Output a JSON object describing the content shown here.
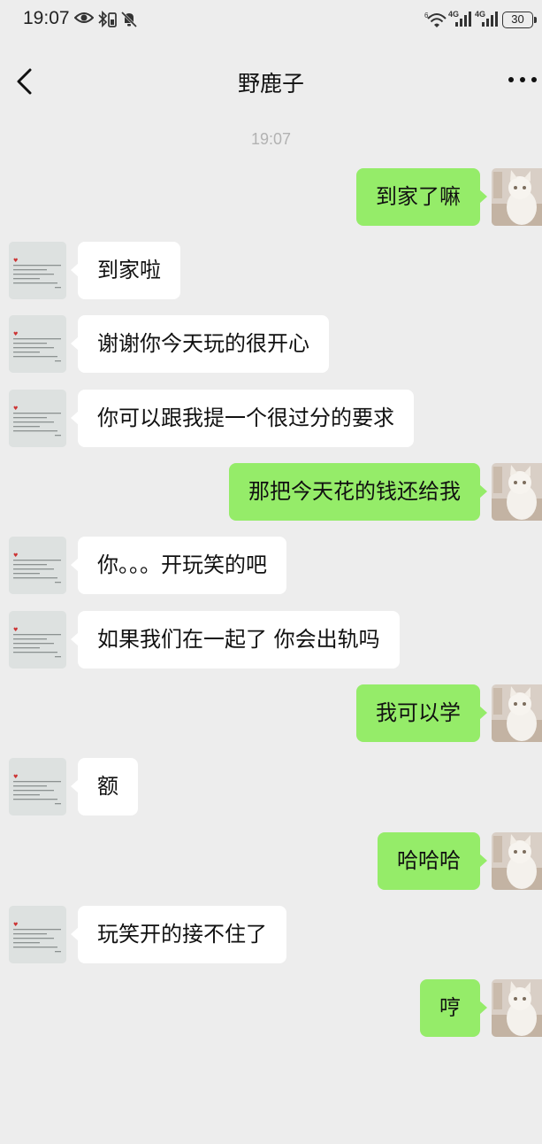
{
  "status_bar": {
    "time": "19:07",
    "battery": "30",
    "left_icons": [
      "eye-icon",
      "bluetooth-battery-icon",
      "mute-bell-icon"
    ],
    "right_icons": [
      "wifi-6-icon",
      "signal-4g-icon",
      "signal-4g-icon"
    ]
  },
  "header": {
    "title": "野鹿子",
    "back_icon": "chevron-left-icon",
    "more_icon": "more-dots-icon"
  },
  "timestamp": "19:07",
  "colors": {
    "background": "#ededed",
    "outgoing_bubble": "#95ec69",
    "incoming_bubble": "#ffffff",
    "timestamp_text": "#b2b2b2"
  },
  "messages": [
    {
      "side": "out",
      "text": "到家了嘛"
    },
    {
      "side": "in",
      "text": "到家啦"
    },
    {
      "side": "in",
      "text": "谢谢你今天玩的很开心"
    },
    {
      "side": "in",
      "text": "你可以跟我提一个很过分的要求"
    },
    {
      "side": "out",
      "text": "那把今天花的钱还给我"
    },
    {
      "side": "in",
      "text": "你。。。开玩笑的吧"
    },
    {
      "side": "in",
      "text": "如果我们在一起了 你会出轨吗"
    },
    {
      "side": "out",
      "text": "我可以学"
    },
    {
      "side": "in",
      "text": "额"
    },
    {
      "side": "out",
      "text": "哈哈哈"
    },
    {
      "side": "in",
      "text": "玩笑开的接不住了"
    },
    {
      "side": "out",
      "text": "哼"
    }
  ]
}
